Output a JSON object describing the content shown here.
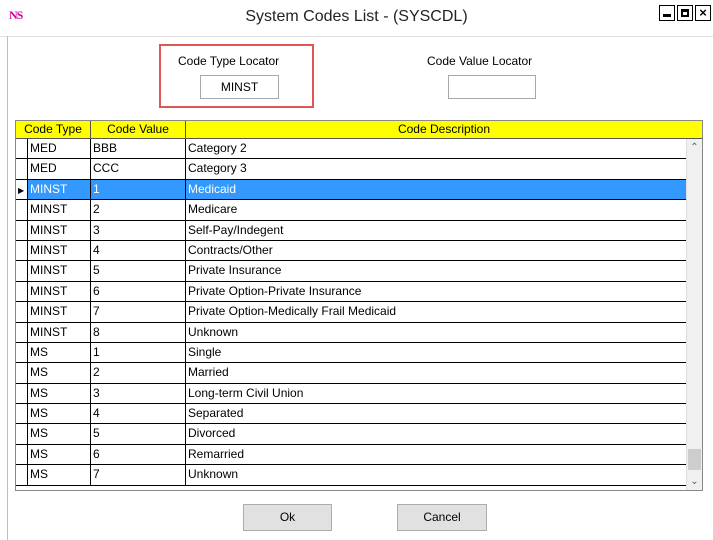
{
  "window": {
    "app_logo": "NS",
    "title": "System Codes List - (SYSCDL)",
    "controls": {
      "minimize": "minimize-icon",
      "maximize": "maximize-icon",
      "close": "×"
    }
  },
  "locators": {
    "type_label": "Code Type Locator",
    "type_value": "MINST",
    "value_label": "Code Value Locator",
    "value_value": ""
  },
  "grid": {
    "headers": [
      "Code Type",
      "Code Value",
      "Code Description"
    ],
    "header_color": "#ffff00",
    "selected_color": "#3399ff",
    "selected_row_marker": "▶",
    "rows": [
      {
        "type": "MED",
        "value": "BBB",
        "desc": "Category 2"
      },
      {
        "type": "MED",
        "value": "CCC",
        "desc": "Category 3"
      },
      {
        "type": "MINST",
        "value": "1",
        "desc": "Medicaid",
        "selected": true
      },
      {
        "type": "MINST",
        "value": "2",
        "desc": "Medicare"
      },
      {
        "type": "MINST",
        "value": "3",
        "desc": "Self-Pay/Indegent"
      },
      {
        "type": "MINST",
        "value": "4",
        "desc": "Contracts/Other"
      },
      {
        "type": "MINST",
        "value": "5",
        "desc": "Private Insurance"
      },
      {
        "type": "MINST",
        "value": "6",
        "desc": "Private Option-Private Insurance"
      },
      {
        "type": "MINST",
        "value": "7",
        "desc": "Private Option-Medically Frail Medicaid"
      },
      {
        "type": "MINST",
        "value": "8",
        "desc": "Unknown"
      },
      {
        "type": "MS",
        "value": "1",
        "desc": "Single"
      },
      {
        "type": "MS",
        "value": "2",
        "desc": "Married"
      },
      {
        "type": "MS",
        "value": "3",
        "desc": "Long-term Civil Union"
      },
      {
        "type": "MS",
        "value": "4",
        "desc": "Separated"
      },
      {
        "type": "MS",
        "value": "5",
        "desc": "Divorced"
      },
      {
        "type": "MS",
        "value": "6",
        "desc": "Remarried"
      },
      {
        "type": "MS",
        "value": "7",
        "desc": "Unknown"
      }
    ]
  },
  "buttons": {
    "ok": "Ok",
    "cancel": "Cancel"
  }
}
